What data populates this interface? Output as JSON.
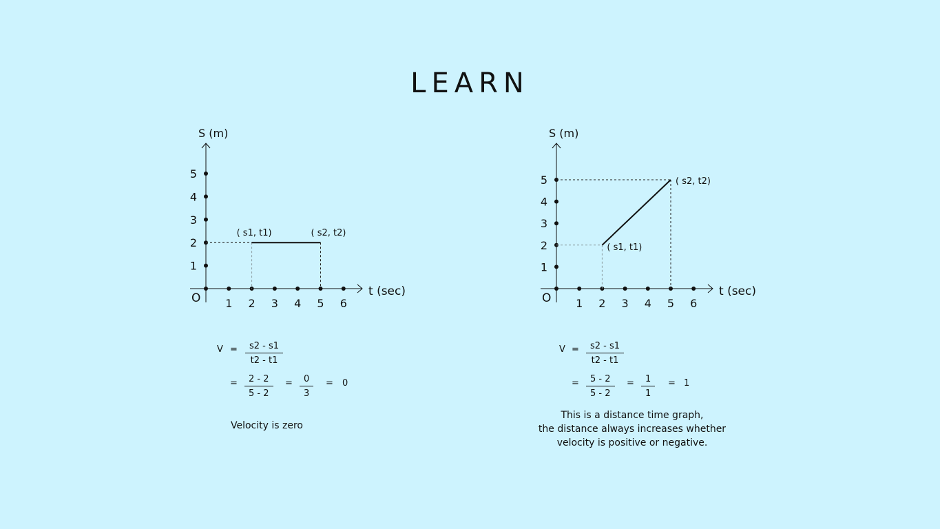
{
  "title": "LEARN",
  "chart_data": [
    {
      "type": "line",
      "xlabel": "t (sec)",
      "ylabel": "S (m)",
      "origin_label": "O",
      "x_ticks": [
        1,
        2,
        3,
        4,
        5,
        6
      ],
      "y_ticks": [
        1,
        2,
        3,
        4,
        5
      ],
      "xlim": [
        0,
        6
      ],
      "ylim": [
        0,
        5
      ],
      "series": [
        {
          "x": [
            2,
            5
          ],
          "y": [
            2,
            2
          ]
        }
      ],
      "annotations": [
        {
          "text": "( s1, t1)",
          "x": 2,
          "y": 2,
          "position": "above-left"
        },
        {
          "text": "( s2, t2)",
          "x": 5,
          "y": 2,
          "position": "above"
        }
      ],
      "guides": [
        {
          "x": 2,
          "y": 2,
          "style": "light-dashed"
        },
        {
          "x": 5,
          "y": 2,
          "style": "dashed"
        }
      ]
    },
    {
      "type": "line",
      "xlabel": "t (sec)",
      "ylabel": "S (m)",
      "origin_label": "O",
      "x_ticks": [
        1,
        2,
        3,
        4,
        5,
        6
      ],
      "y_ticks": [
        1,
        2,
        3,
        4,
        5
      ],
      "xlim": [
        0,
        6
      ],
      "ylim": [
        0,
        5
      ],
      "series": [
        {
          "x": [
            2,
            5
          ],
          "y": [
            2,
            5
          ]
        }
      ],
      "annotations": [
        {
          "text": "( s1, t1)",
          "x": 2,
          "y": 2,
          "position": "below-right"
        },
        {
          "text": "( s2, t2)",
          "x": 5,
          "y": 5,
          "position": "right"
        }
      ],
      "guides": [
        {
          "x": 2,
          "y": 2,
          "style": "light-dashed"
        },
        {
          "x": 5,
          "y": 5,
          "style": "dashed"
        }
      ]
    }
  ],
  "formulas": [
    {
      "v_label": "V",
      "eq": "=",
      "def_num": "s2 - s1",
      "def_den": "t2 - t1",
      "sub_num": "2 - 2",
      "sub_den": "5 - 2",
      "simp_num": "0",
      "simp_den": "3",
      "result": "0",
      "note": "Velocity is zero"
    },
    {
      "v_label": "V",
      "eq": "=",
      "def_num": "s2 - s1",
      "def_den": "t2 - t1",
      "sub_num": "5 - 2",
      "sub_den": "5 - 2",
      "simp_num": "1",
      "simp_den": "1",
      "result": "1",
      "note_lines": [
        "This is a distance time graph,",
        "the distance always increases whether",
        "velocity is positive or negative."
      ]
    }
  ]
}
